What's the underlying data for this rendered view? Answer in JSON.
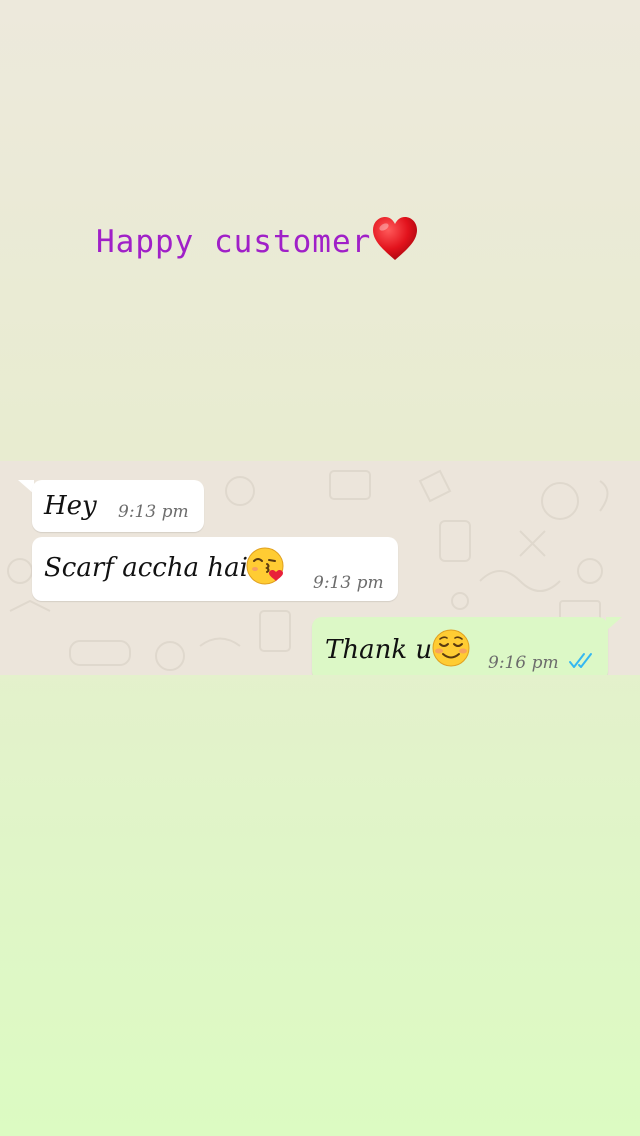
{
  "title": {
    "text": "Happy customer",
    "heart_icon": "red-heart-icon",
    "color": "#a020c8"
  },
  "chat": {
    "background_color": "#ece5db",
    "incoming_bubble_color": "#ffffff",
    "outgoing_bubble_color": "#dcf8c6",
    "messages": [
      {
        "direction": "incoming",
        "text": "Hey",
        "time": "9:13 pm"
      },
      {
        "direction": "incoming",
        "text": "Scarf accha hai",
        "emoji": "kissing-face-with-heart-emoji",
        "time": "9:13 pm"
      },
      {
        "direction": "outgoing",
        "text": "Thank u",
        "emoji": "smiling-face-emoji",
        "time": "9:16 pm",
        "status_icon": "double-blue-tick-icon",
        "status_color": "#34b7f1"
      }
    ]
  }
}
